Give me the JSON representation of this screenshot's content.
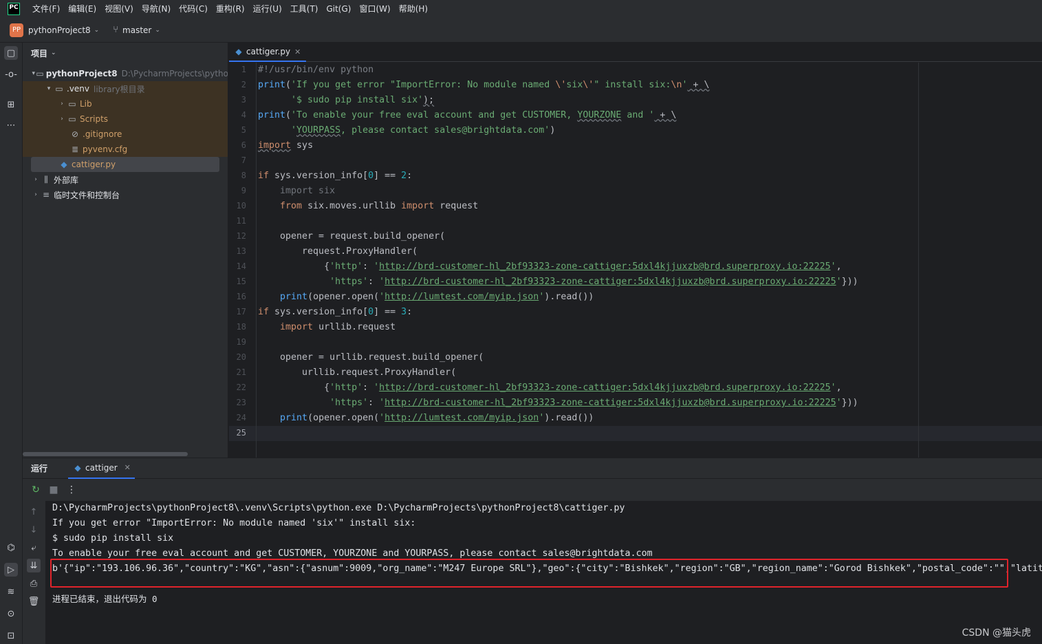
{
  "menu": {
    "logo": "PC",
    "items": [
      "文件(F)",
      "编辑(E)",
      "视图(V)",
      "导航(N)",
      "代码(C)",
      "重构(R)",
      "运行(U)",
      "工具(T)",
      "Git(G)",
      "窗口(W)",
      "帮助(H)"
    ]
  },
  "toolbar": {
    "project_badge": "PP",
    "project_name": "pythonProject8",
    "branch": "master"
  },
  "project_panel": {
    "title": "项目",
    "root_name": "pythonProject8",
    "root_path": "D:\\PycharmProjects\\pytho",
    "venv_name": ".venv",
    "venv_hint": "library根目录",
    "lib": "Lib",
    "scripts": "Scripts",
    "gitignore": ".gitignore",
    "pyvenv": "pyvenv.cfg",
    "cattiger": "cattiger.py",
    "external_libs": "外部库",
    "scratches": "临时文件和控制台"
  },
  "editor": {
    "tab_label": "cattiger.py",
    "line_numbers": [
      "1",
      "2",
      "3",
      "4",
      "5",
      "6",
      "7",
      "8",
      "9",
      "10",
      "11",
      "12",
      "13",
      "14",
      "15",
      "16",
      "17",
      "18",
      "19",
      "20",
      "21",
      "22",
      "23",
      "24",
      "25"
    ],
    "code": {
      "l1": "#!/usr/bin/env python",
      "l2_print": "print",
      "l2_a": "(",
      "l2_str1": "'If you get error \"ImportError: No module named ",
      "l2_esc1": "\\'",
      "l2_str2": "six",
      "l2_esc2": "\\'",
      "l2_str3": "\" install six:",
      "l2_esc3": "\\n",
      "l2_str4": "'",
      "l2_tail": " + \\",
      "l3_str": "      '$ sudo pip install six'",
      "l3_tail": ");",
      "l4_print": "print",
      "l4_a": "(",
      "l4_str1": "'To enable your free eval account and get CUSTOMER, ",
      "l4_yz": "YOURZONE",
      "l4_str2": " and '",
      "l4_tail": " + \\",
      "l5_pre": "      '",
      "l5_yp": "YOURPASS",
      "l5_str": ", please contact sales@brightdata.com'",
      "l5_tail": ")",
      "l6_kw": "import",
      "l6_rest": " sys",
      "l8_kw": "if",
      "l8_a": " sys.version_info[",
      "l8_n1": "0",
      "l8_b": "] == ",
      "l8_n2": "2",
      "l8_c": ":",
      "l9": "    import six",
      "l10_kw1": "from",
      "l10_a": " six.moves.urllib ",
      "l10_kw2": "import",
      "l10_b": " request",
      "l12": "    opener = request.build_opener(",
      "l13": "        request.ProxyHandler(",
      "l14_a": "            {",
      "l14_k": "'http'",
      "l14_b": ": ",
      "l14_q1": "'",
      "l14_url": "http://brd-customer-hl_2bf93323-zone-cattiger:5dxl4kjjuxzb@brd.superproxy.io:22225",
      "l14_q2": "'",
      "l14_c": ",",
      "l15_a": "             ",
      "l15_k": "'https'",
      "l15_b": ": ",
      "l15_q1": "'",
      "l15_url": "http://brd-customer-hl_2bf93323-zone-cattiger:5dxl4kjjuxzb@brd.superproxy.io:22225",
      "l15_q2": "'",
      "l15_c": "}))",
      "l16_a": "    ",
      "l16_fn": "print",
      "l16_b": "(opener.open(",
      "l16_q1": "'",
      "l16_url": "http://lumtest.com/myip.json",
      "l16_q2": "'",
      "l16_c": ").read())",
      "l17_kw": "if",
      "l17_a": " sys.version_info[",
      "l17_n1": "0",
      "l17_b": "] == ",
      "l17_n2": "3",
      "l17_c": ":",
      "l18_a": "    ",
      "l18_kw": "import",
      "l18_b": " urllib.request",
      "l20": "    opener = urllib.request.build_opener(",
      "l21": "        urllib.request.ProxyHandler(",
      "l22_a": "            {",
      "l22_k": "'http'",
      "l22_b": ": ",
      "l22_q1": "'",
      "l22_url": "http://brd-customer-hl_2bf93323-zone-cattiger:5dxl4kjjuxzb@brd.superproxy.io:22225",
      "l22_q2": "'",
      "l22_c": ",",
      "l23_a": "             ",
      "l23_k": "'https'",
      "l23_b": ": ",
      "l23_q1": "'",
      "l23_url": "http://brd-customer-hl_2bf93323-zone-cattiger:5dxl4kjjuxzb@brd.superproxy.io:22225",
      "l23_q2": "'",
      "l23_c": "}))",
      "l24_a": "    ",
      "l24_fn": "print",
      "l24_b": "(opener.open(",
      "l24_q1": "'",
      "l24_url": "http://lumtest.com/myip.json",
      "l24_q2": "'",
      "l24_c": ").read())"
    }
  },
  "run_panel": {
    "title": "运行",
    "tab_label": "cattiger",
    "console": {
      "cmd": "D:\\PycharmProjects\\pythonProject8\\.venv\\Scripts\\python.exe D:\\PycharmProjects\\pythonProject8\\cattiger.py",
      "line1": "If you get error \"ImportError: No module named 'six'\" install six:",
      "line2": "$ sudo pip install six",
      "line3": "To enable your free eval account and get CUSTOMER, YOURZONE and YOURPASS, please contact sales@brightdata.com",
      "line4": "b'{\"ip\":\"193.106.96.36\",\"country\":\"KG\",\"asn\":{\"asnum\":9009,\"org_name\":\"M247 Europe SRL\"},\"geo\":{\"city\":\"Bishkek\",\"region\":\"GB\",\"region_name\":\"Gorod Bishkek\",\"postal_code\":\"\",\"latit",
      "exit": "进程已结束，退出代码为 0"
    }
  },
  "watermark": "CSDN @猫头虎",
  "colors": {
    "accent": "#3574f0",
    "highlight_box": "#e0242b",
    "string": "#6aab73",
    "keyword": "#cf8e6d"
  }
}
